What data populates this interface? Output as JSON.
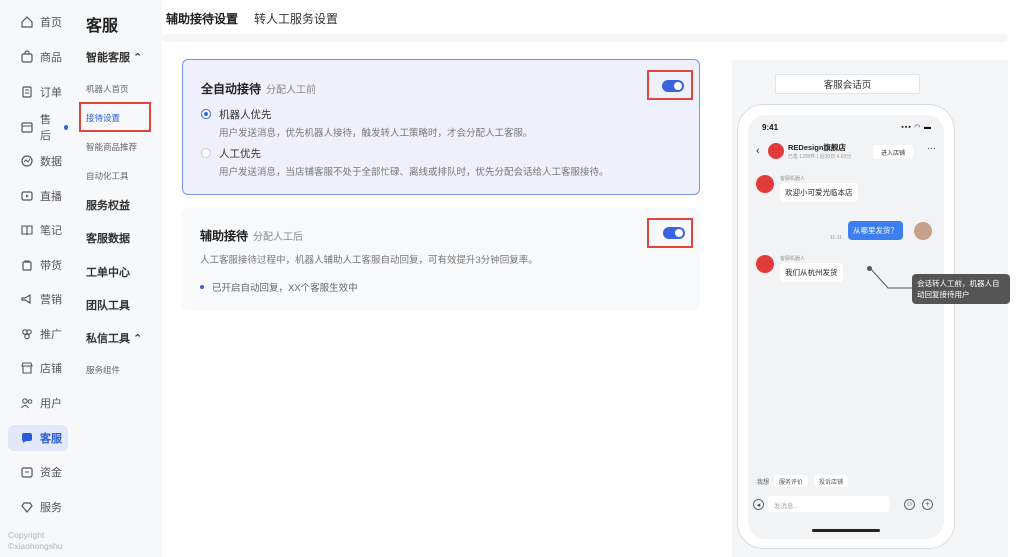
{
  "rail": {
    "items": [
      {
        "label": "首页",
        "icon": "home-icon"
      },
      {
        "label": "商品",
        "icon": "bag-icon"
      },
      {
        "label": "订单",
        "icon": "order-icon"
      },
      {
        "label": "售后",
        "icon": "aftersale-icon"
      },
      {
        "label": "数据",
        "icon": "data-icon"
      },
      {
        "label": "直播",
        "icon": "live-icon"
      },
      {
        "label": "笔记",
        "icon": "notes-icon"
      },
      {
        "label": "带货",
        "icon": "promote-icon"
      },
      {
        "label": "营销",
        "icon": "megaphone-icon"
      },
      {
        "label": "推广",
        "icon": "spread-icon"
      },
      {
        "label": "店铺",
        "icon": "store-icon"
      },
      {
        "label": "用户",
        "icon": "users-icon"
      },
      {
        "label": "客服",
        "icon": "chat-icon"
      },
      {
        "label": "资金",
        "icon": "wallet-icon"
      },
      {
        "label": "服务",
        "icon": "service-icon"
      }
    ],
    "active": "客服",
    "copyright_1": "Copyright",
    "copyright_2": "©xiaohongshu"
  },
  "subnav": {
    "title": "客服",
    "group_smart": "智能客服 ⌃",
    "item_robot_home": "机器人首页",
    "item_reception": "接待设置",
    "item_product_rec": "智能商品推荐",
    "item_automation": "自动化工具",
    "group_rights": "服务权益",
    "group_data": "客服数据",
    "group_tickets": "工单中心",
    "group_team": "团队工具",
    "group_private": "私信工具 ⌃",
    "item_components": "服务组件"
  },
  "tabs": [
    "辅助接待设置",
    "转人工服务设置"
  ],
  "card_auto": {
    "title": "全自动接待",
    "subtitle": "分配人工前",
    "enabled": true,
    "option1_label": "机器人优先",
    "option1_desc": "用户发送消息，优先机器人接待，触发转人工策略时，才会分配人工客服。",
    "option2_label": "人工优先",
    "option2_desc": "用户发送消息，当店铺客服不处于全部忙碌、离线或排队时，优先分配会话给人工客服接待。",
    "selected": "机器人优先"
  },
  "card_assist": {
    "title": "辅助接待",
    "subtitle": "分配人工后",
    "enabled": true,
    "desc": "人工客服接待过程中，机器人辅助人工客服自动回复，可有效提升3分钟回复率。",
    "status": "已开启自动回复，XX个客服生效中"
  },
  "preview": {
    "label": "客服会话页",
    "time": "9:41",
    "signal": "▪▪▪ ◠ ▬",
    "shop_name": "REDesign旗舰店",
    "shop_meta": "已售 1289件 | 近30日 4.03分",
    "enter_shop": "进入店铺",
    "more": "···",
    "bot_tag": "客服机器人",
    "msg_welcome": "欢迎小可爱光临本店",
    "msg_user": "从哪里发货？",
    "msg_user_time": "11:11",
    "msg_reply": "我们从杭州发货",
    "tooltip": "会话转人工前，机器人自动回复接待用户",
    "quick": [
      "我想",
      "服务评价",
      "投诉店铺"
    ],
    "input_placeholder": "发消息...",
    "accent": "#3a63e0",
    "highlight": "#e0463a"
  }
}
